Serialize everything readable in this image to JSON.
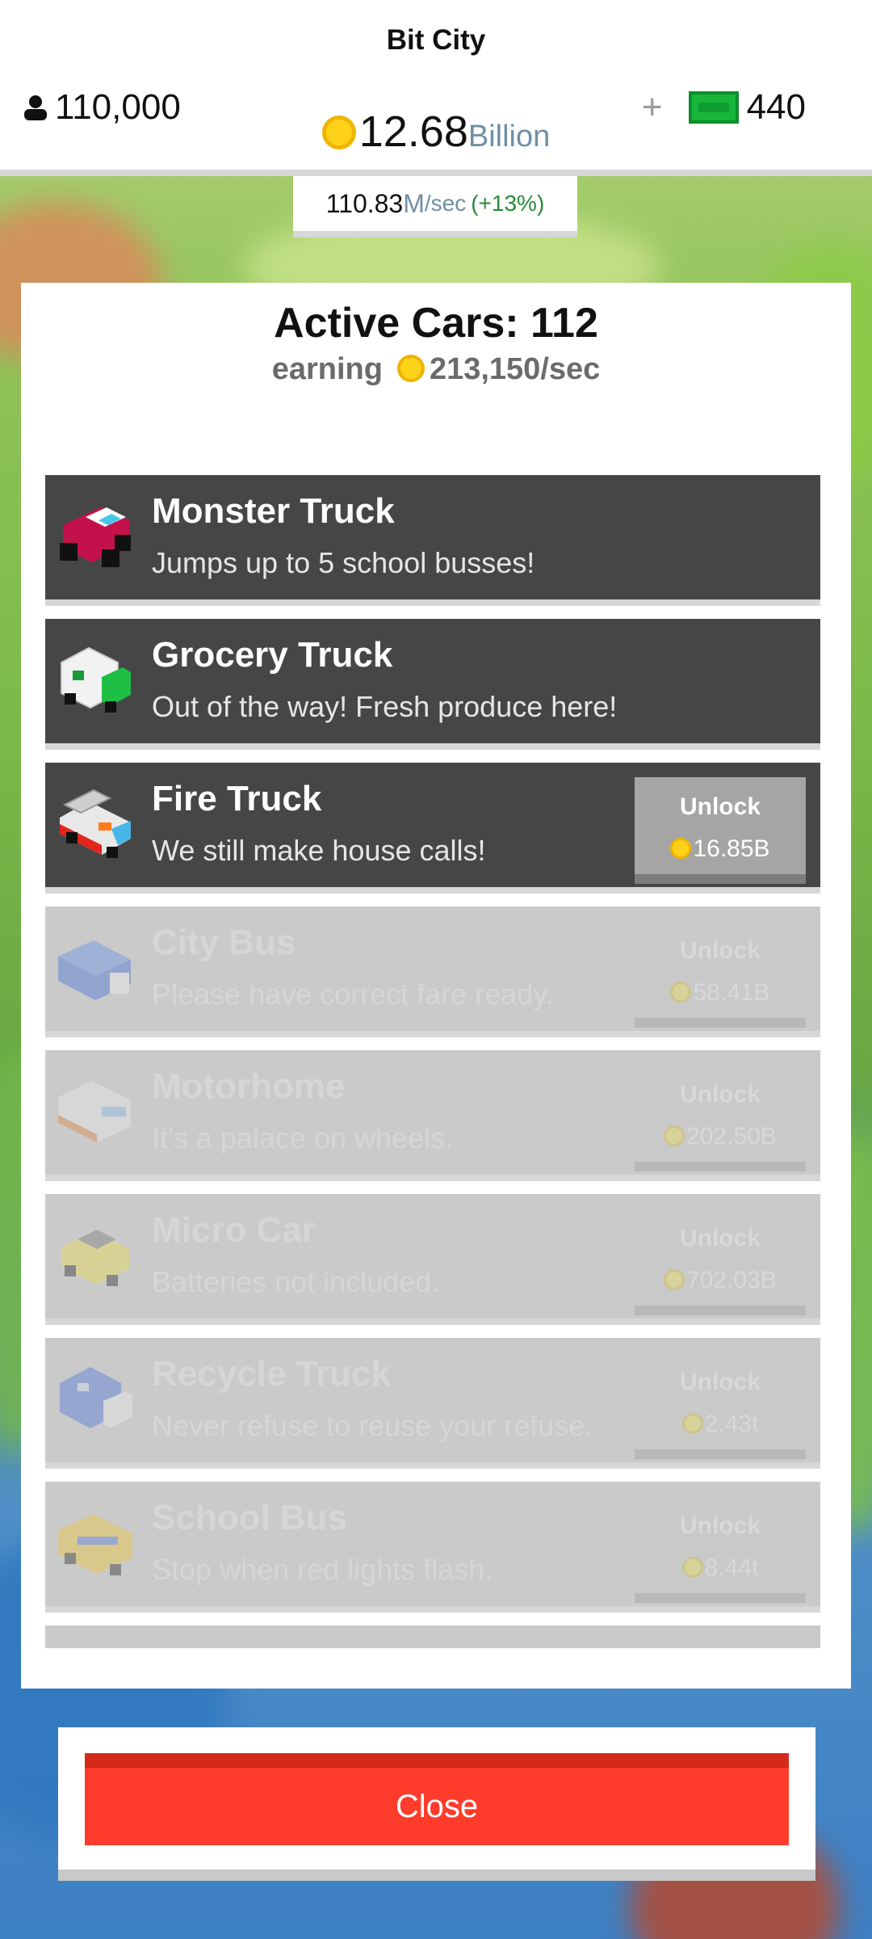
{
  "header": {
    "title": "Bit City",
    "population": "110,000",
    "coins_value": "12.68",
    "coins_unit": "Billion",
    "cash": "440",
    "plus": "+",
    "rate_value": "110.83",
    "rate_unit": "M",
    "rate_suffix": "/sec",
    "rate_bonus": "(+13%)"
  },
  "panel": {
    "title": "Active Cars: 112",
    "earning_label": "earning",
    "earning_value": "213,150/sec"
  },
  "cars": [
    {
      "name": "Monster Truck",
      "desc": "Jumps up to 5 school busses!",
      "icon": "monster-truck-icon"
    },
    {
      "name": "Grocery Truck",
      "desc": "Out of the way! Fresh produce here!",
      "icon": "grocery-truck-icon"
    },
    {
      "name": "Fire Truck",
      "desc": "We still make house calls!",
      "unlock": "Unlock",
      "price": "16.85B",
      "icon": "fire-truck-icon"
    },
    {
      "name": "City Bus",
      "desc": "Please have correct fare ready.",
      "unlock": "Unlock",
      "price": "58.41B",
      "icon": "city-bus-icon"
    },
    {
      "name": "Motorhome",
      "desc": "It's a palace on wheels.",
      "unlock": "Unlock",
      "price": "202.50B",
      "icon": "motorhome-icon"
    },
    {
      "name": "Micro Car",
      "desc": "Batteries not included.",
      "unlock": "Unlock",
      "price": "702.03B",
      "icon": "micro-car-icon"
    },
    {
      "name": "Recycle Truck",
      "desc": "Never refuse to reuse your refuse.",
      "unlock": "Unlock",
      "price": "2.43t",
      "icon": "recycle-truck-icon"
    },
    {
      "name": "School Bus",
      "desc": "Stop when red lights flash.",
      "unlock": "Unlock",
      "price": "8.44t",
      "icon": "school-bus-icon"
    }
  ],
  "close_label": "Close",
  "colors": {
    "accent_red": "#ff3b2b",
    "row_dark": "#464646",
    "row_locked": "#cacaca",
    "coin": "#ffd21a",
    "cash": "#16b63a"
  }
}
